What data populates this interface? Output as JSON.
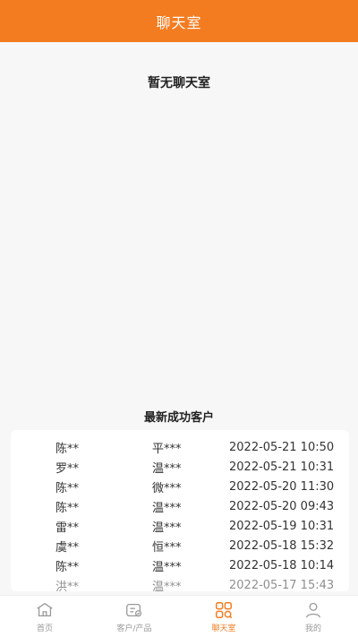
{
  "header": {
    "title": "聊天室"
  },
  "main": {
    "empty_text": "暂无聊天室"
  },
  "recent": {
    "title": "最新成功客户",
    "rows": [
      {
        "customer": "陈**",
        "agent": "平***",
        "time": "2022-05-21 10:50"
      },
      {
        "customer": "罗**",
        "agent": "温***",
        "time": "2022-05-21 10:31"
      },
      {
        "customer": "陈**",
        "agent": "微***",
        "time": "2022-05-20 11:30"
      },
      {
        "customer": "陈**",
        "agent": "温***",
        "time": "2022-05-20 09:43"
      },
      {
        "customer": "雷**",
        "agent": "温***",
        "time": "2022-05-19 10:31"
      },
      {
        "customer": "虞**",
        "agent": "恒***",
        "time": "2022-05-18 15:32"
      },
      {
        "customer": "陈**",
        "agent": "温***",
        "time": "2022-05-18 10:14"
      },
      {
        "customer": "洪**",
        "agent": "温***",
        "time": "2022-05-17 15:43"
      }
    ]
  },
  "tabbar": {
    "items": [
      {
        "label": "首页",
        "icon": "home-icon"
      },
      {
        "label": "客户/产品",
        "icon": "customer-product-icon"
      },
      {
        "label": "聊天室",
        "icon": "chatroom-grid-icon",
        "active": true
      },
      {
        "label": "我的",
        "icon": "user-icon"
      }
    ]
  },
  "colors": {
    "accent": "#f47c20",
    "background": "#f7f7f7"
  }
}
